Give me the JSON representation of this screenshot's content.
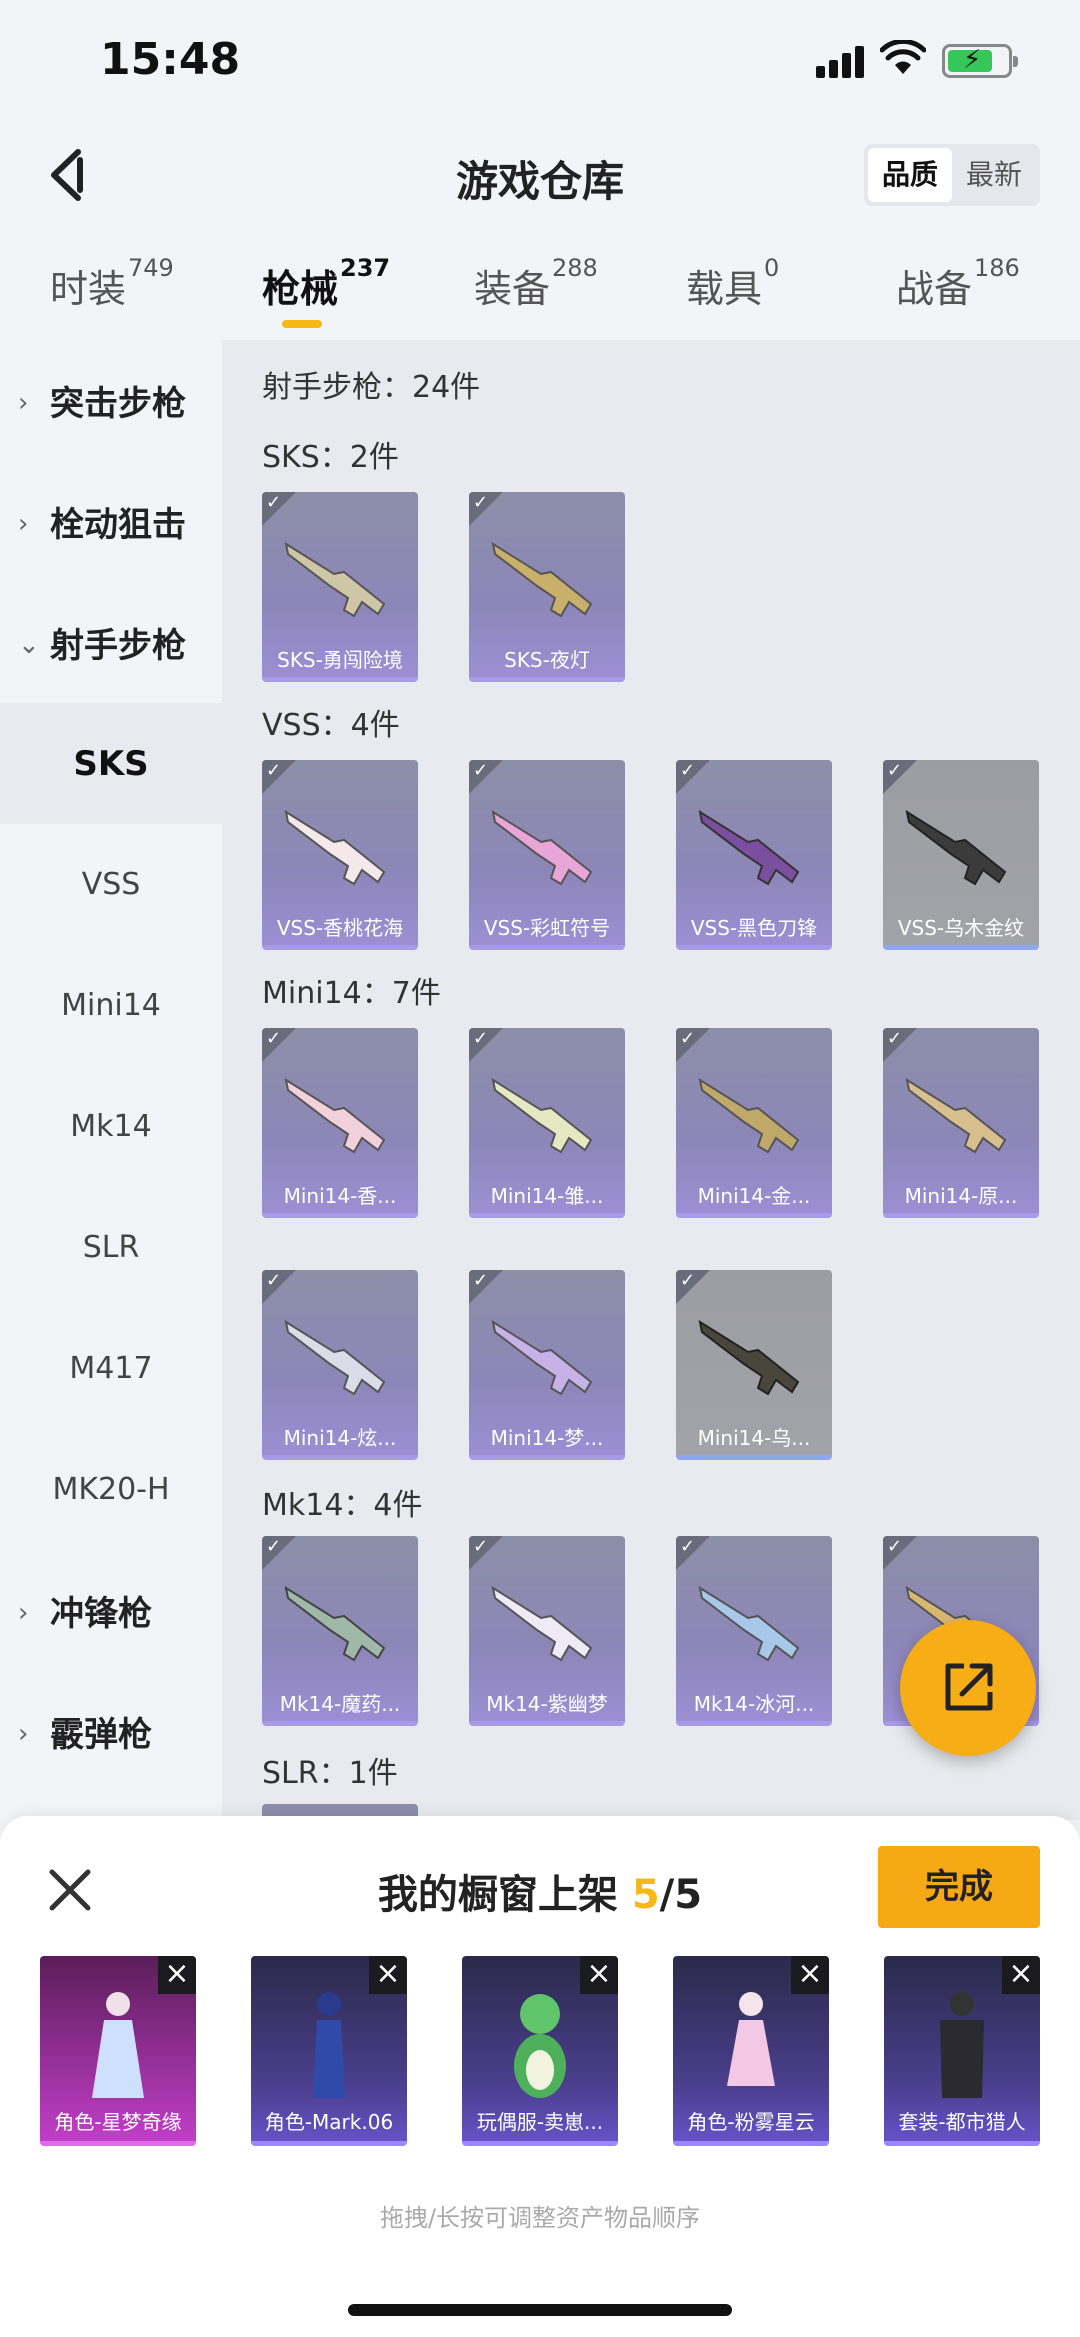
{
  "status": {
    "time": "15:48"
  },
  "header": {
    "title": "游戏仓库",
    "sort_quality": "品质",
    "sort_latest": "最新"
  },
  "tabs": [
    {
      "label": "时装",
      "count": "749"
    },
    {
      "label": "枪械",
      "count": "237"
    },
    {
      "label": "装备",
      "count": "288"
    },
    {
      "label": "载具",
      "count": "0"
    },
    {
      "label": "战备",
      "count": "186"
    }
  ],
  "sidebar": [
    {
      "label": "突击步枪"
    },
    {
      "label": "栓动狙击"
    },
    {
      "label": "射手步枪"
    },
    {
      "label": "SKS"
    },
    {
      "label": "VSS"
    },
    {
      "label": "Mini14"
    },
    {
      "label": "Mk14"
    },
    {
      "label": "SLR"
    },
    {
      "label": "M417"
    },
    {
      "label": "MK20-H"
    },
    {
      "label": "冲锋枪"
    },
    {
      "label": "霰弹枪"
    }
  ],
  "content": {
    "category_title": "射手步枪：24件",
    "sections": [
      {
        "title": "SKS：2件",
        "items": [
          "SKS-勇闯险境",
          "SKS-夜灯"
        ]
      },
      {
        "title": "VSS：4件",
        "items": [
          "VSS-香桃花海",
          "VSS-彩虹符号",
          "VSS-黑色刀锋",
          "VSS-乌木金纹"
        ]
      },
      {
        "title": "Mini14：7件",
        "items": [
          "Mini14-香...",
          "Mini14-雏...",
          "Mini14-金...",
          "Mini14-原...",
          "Mini14-炫...",
          "Mini14-梦...",
          "Mini14-乌..."
        ]
      },
      {
        "title": "Mk14：4件",
        "items": [
          "Mk14-魔药...",
          "Mk14-紫幽梦",
          "Mk14-冰河..."
        ]
      },
      {
        "title": "SLR：1件",
        "items": []
      }
    ]
  },
  "panel": {
    "title_prefix": "我的橱窗上架 ",
    "count_current": "5",
    "count_total": "/5",
    "done_label": "完成",
    "slots": [
      "角色-星梦奇缘",
      "角色-Mark.06",
      "玩偶服-卖崽...",
      "角色-粉雾星云",
      "套装-都市猎人"
    ],
    "hint": "拖拽/长按可调整资产物品顺序"
  }
}
